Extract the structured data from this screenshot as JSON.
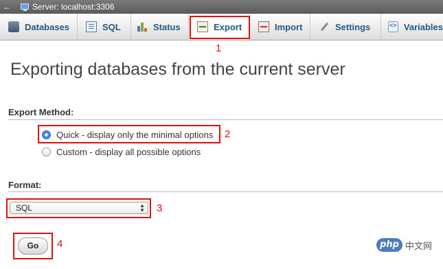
{
  "server_bar": {
    "back": "←",
    "title": "Server: localhost:3306"
  },
  "tabs": [
    {
      "label": "Databases",
      "icon": "database-icon"
    },
    {
      "label": "SQL",
      "icon": "sql-icon"
    },
    {
      "label": "Status",
      "icon": "status-icon"
    },
    {
      "label": "Export",
      "icon": "export-icon"
    },
    {
      "label": "Import",
      "icon": "import-icon"
    },
    {
      "label": "Settings",
      "icon": "settings-icon"
    },
    {
      "label": "Variables",
      "icon": "variables-icon"
    }
  ],
  "page_title": "Exporting databases from the current server",
  "export_method": {
    "label": "Export Method:",
    "options": [
      {
        "label": "Quick - display only the minimal options",
        "checked": true
      },
      {
        "label": "Custom - display all possible options",
        "checked": false
      }
    ]
  },
  "format": {
    "label": "Format:",
    "selected": "SQL",
    "arrows": "▲▼"
  },
  "go_button": "Go",
  "annotations": [
    "1",
    "2",
    "3",
    "4"
  ],
  "watermark": {
    "logo": "php",
    "text": "中文网"
  },
  "colors": {
    "annotation": "#e01010",
    "tab_text": "#235a81",
    "radio_selected": "#3d8fe6"
  }
}
